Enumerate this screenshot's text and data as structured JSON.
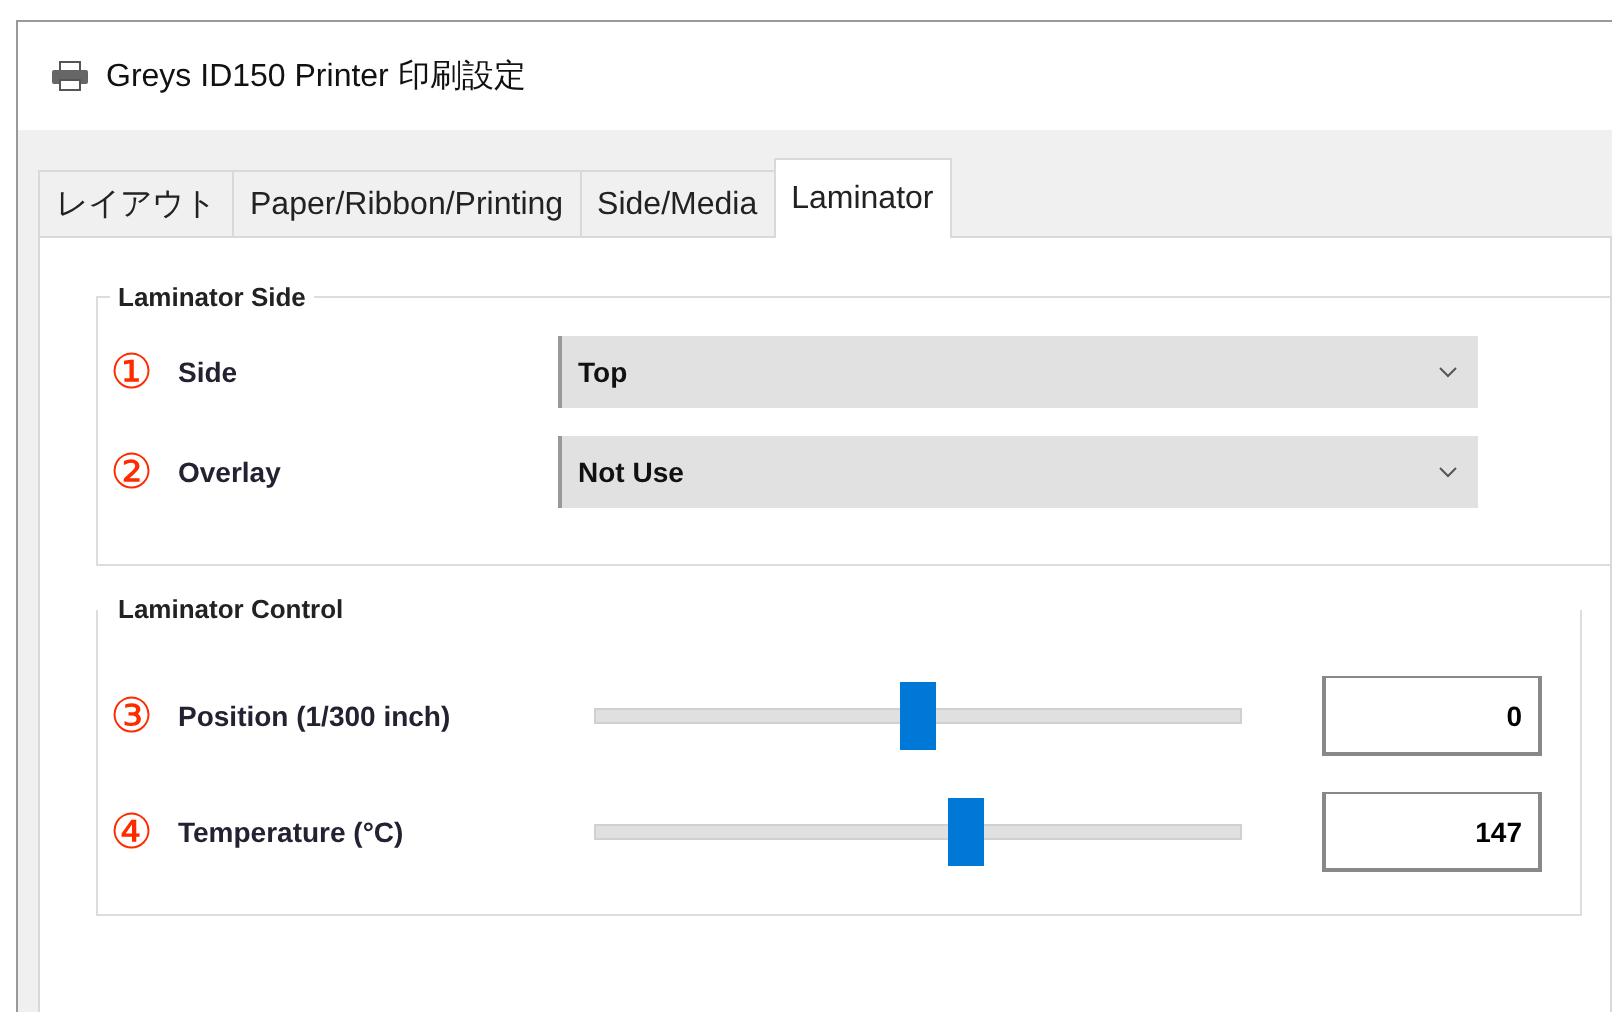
{
  "window": {
    "title": "Greys ID150 Printer 印刷設定"
  },
  "tabs": [
    {
      "label": "レイアウト",
      "selected": false
    },
    {
      "label": "Paper/Ribbon/Printing",
      "selected": false
    },
    {
      "label": "Side/Media",
      "selected": false
    },
    {
      "label": "Laminator",
      "selected": true
    }
  ],
  "laminator_side": {
    "title": "Laminator Side",
    "rows": [
      {
        "marker": "①",
        "label": "Side",
        "value": "Top"
      },
      {
        "marker": "②",
        "label": "Overlay",
        "value": "Not Use"
      }
    ]
  },
  "laminator_control": {
    "title": "Laminator Control",
    "rows": [
      {
        "marker": "③",
        "label": "Position (1/300 inch)",
        "level": 0.5,
        "value": "0"
      },
      {
        "marker": "④",
        "label": "Temperature (°C)",
        "level": 0.575,
        "value": "147"
      }
    ]
  }
}
